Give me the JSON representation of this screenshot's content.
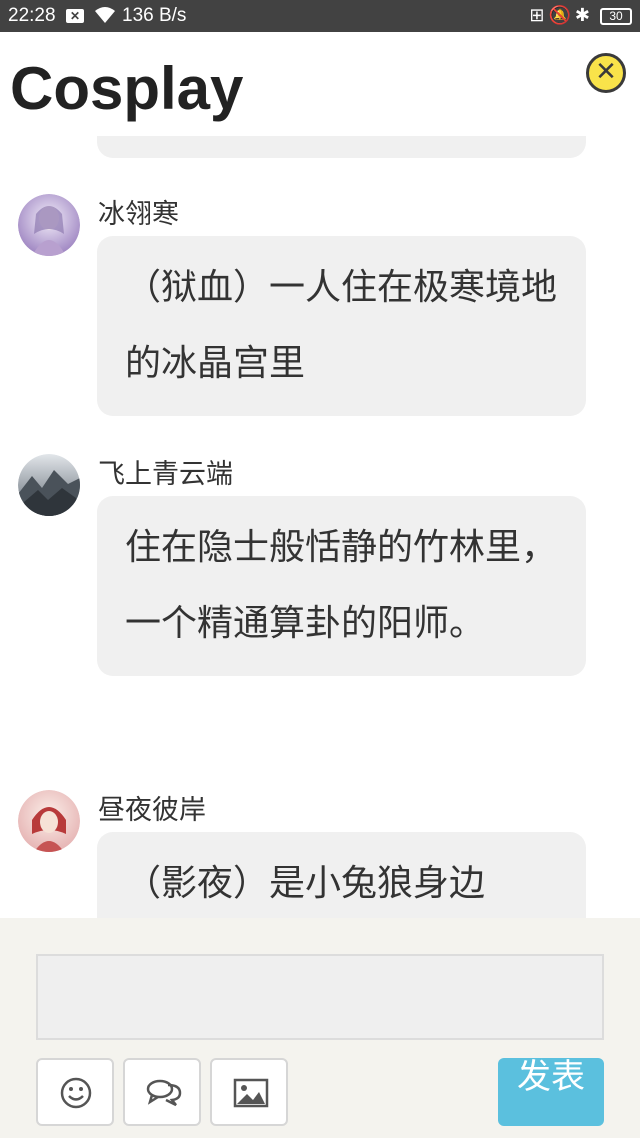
{
  "status_bar": {
    "time": "22:28",
    "network_speed": "136 B/s",
    "battery": "30"
  },
  "header": {
    "title": "Cosplay"
  },
  "messages": [
    {
      "sender": "冰翎寒",
      "text": "（狱血）一人住在极寒境地的冰晶宫里",
      "avatar_colors": [
        "#d8c9e8",
        "#a894c4"
      ]
    },
    {
      "sender": "飞上青云端",
      "text": "住在隐士般恬静的竹林里，一个精通算卦的阳师。",
      "avatar_colors": [
        "#c9ced6",
        "#6b7480"
      ]
    },
    {
      "sender": "昼夜彼岸",
      "text": "（影夜）是小兔狼身边",
      "avatar_colors": [
        "#f4d9d9",
        "#c04848"
      ]
    }
  ],
  "composer": {
    "input_value": "",
    "send_label": "发表"
  },
  "icons": {
    "emoji": "smiley-icon",
    "comment": "chat-bubbles-icon",
    "image": "image-icon",
    "close": "close-icon"
  },
  "colors": {
    "send_button": "#5bc0de",
    "close_button": "#f9e34a",
    "bubble": "#f0f0f0"
  }
}
